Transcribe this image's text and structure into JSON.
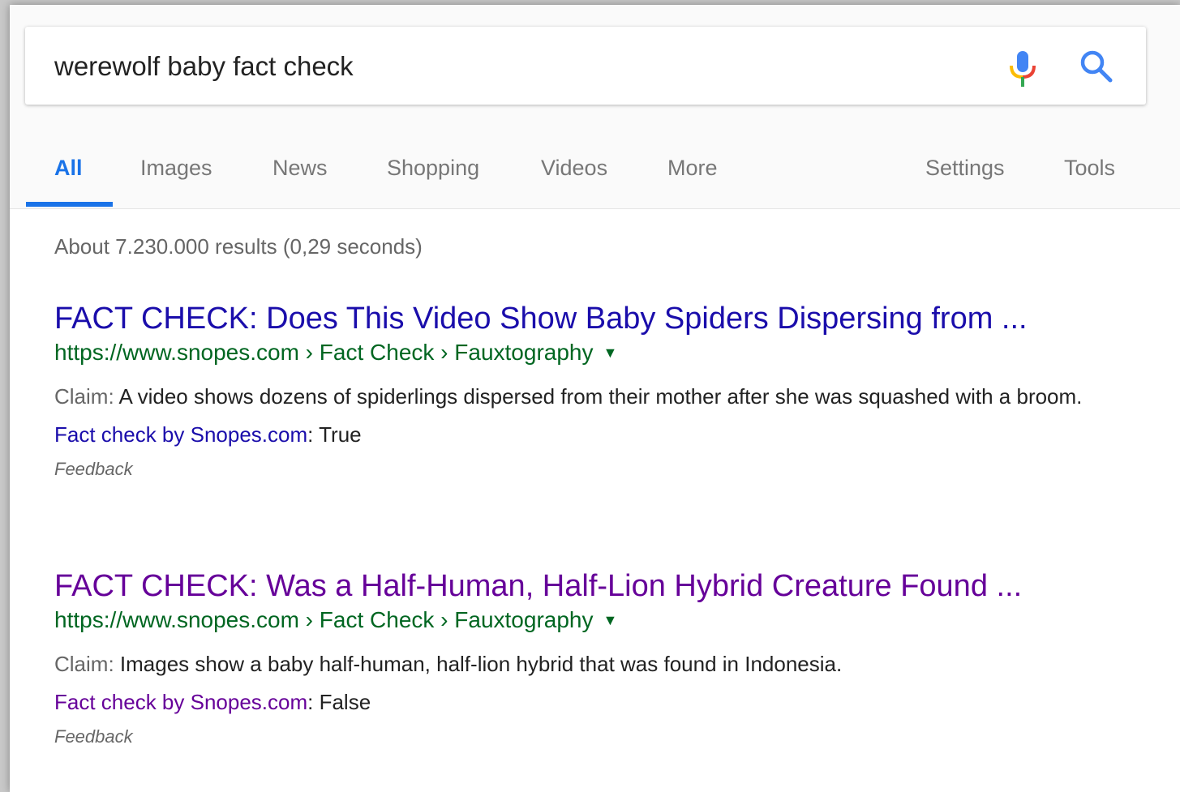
{
  "search": {
    "query": "werewolf baby fact check"
  },
  "tabs": {
    "left": [
      {
        "label": "All"
      },
      {
        "label": "Images"
      },
      {
        "label": "News"
      },
      {
        "label": "Shopping"
      },
      {
        "label": "Videos"
      },
      {
        "label": "More"
      }
    ],
    "right": [
      {
        "label": "Settings"
      },
      {
        "label": "Tools"
      }
    ],
    "active": "All"
  },
  "result_stats": "About 7.230.000 results (0,29 seconds)",
  "results": [
    {
      "title": "FACT CHECK: Does This Video Show Baby Spiders Dispersing from ...",
      "url": "https://www.snopes.com › Fact Check › Fauxtography",
      "url_dropdown": "▼",
      "claim_label": "Claim:",
      "claim_text": " A video shows dozens of spiderlings dispersed from their mother after she was squashed with a broom.",
      "fact_check_label": "Fact check by Snopes.com",
      "fact_check_sep": ": ",
      "fact_check_rating": "True",
      "feedback": "Feedback",
      "visited": false
    },
    {
      "title": "FACT CHECK: Was a Half-Human, Half-Lion Hybrid Creature Found ...",
      "url": "https://www.snopes.com › Fact Check › Fauxtography",
      "url_dropdown": "▼",
      "claim_label": "Claim:",
      "claim_text": " Images show a baby half-human, half-lion hybrid that was found in Indonesia.",
      "fact_check_label": "Fact check by Snopes.com",
      "fact_check_sep": ": ",
      "fact_check_rating": "False",
      "feedback": "Feedback",
      "visited": true
    }
  ],
  "colors": {
    "accent": "#1a73e8",
    "link_unvisited": "#1a0dab",
    "link_visited": "#660099",
    "url_green": "#006621",
    "mic_blue": "#4285f4",
    "mic_red": "#ea4335",
    "mic_yellow": "#fbbc05",
    "mic_green": "#34a853"
  },
  "icons": {
    "mic": "microphone-icon",
    "search": "search-icon",
    "dropdown": "caret-down-icon"
  }
}
